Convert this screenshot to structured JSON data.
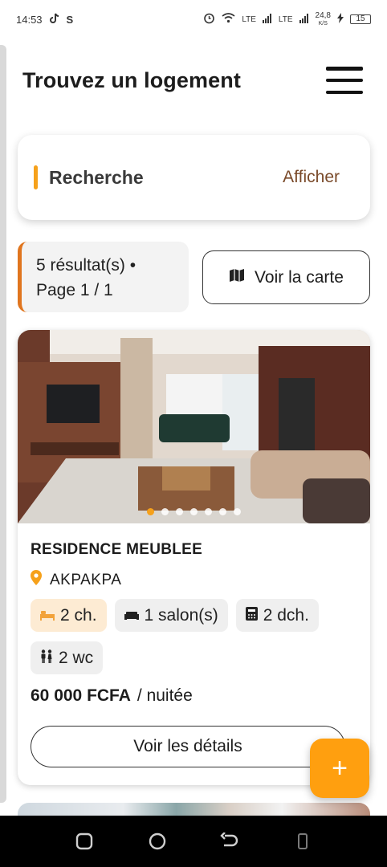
{
  "status_bar": {
    "time": "14:53",
    "network_1": "LTE",
    "network_2": "LTE",
    "speed": "24,8",
    "speed_unit": "K/S",
    "battery": "15"
  },
  "header": {
    "title": "Trouvez un logement",
    "menu_icon": "hamburger-icon"
  },
  "search": {
    "title": "Recherche",
    "toggle_label": "Afficher"
  },
  "results": {
    "summary_line1": "5 résultat(s) •",
    "summary_line2": "Page 1 / 1",
    "map_button_label": "Voir la carte",
    "map_icon": "map-icon"
  },
  "listing": {
    "name": "RESIDENCE MEUBLEE",
    "location": "AKPAKPA",
    "photo_count": 7,
    "active_photo_index": 0,
    "features": [
      {
        "icon": "bed-icon",
        "label": "2 ch."
      },
      {
        "icon": "sofa-icon",
        "label": "1 salon(s)"
      },
      {
        "icon": "bathroom-icon",
        "label": "2 dch."
      },
      {
        "icon": "toilet-icon",
        "label": "2 wc"
      }
    ],
    "price": "60 000 FCFA",
    "price_unit": "/ nuitée",
    "details_button_label": "Voir les détails"
  },
  "fab": {
    "label": "+",
    "icon": "plus-icon"
  },
  "colors": {
    "accent_orange": "#ff9f0f",
    "results_border": "#e0751e",
    "chip_highlight": "#fdebd3",
    "toggle_text": "#7a4a2a"
  }
}
